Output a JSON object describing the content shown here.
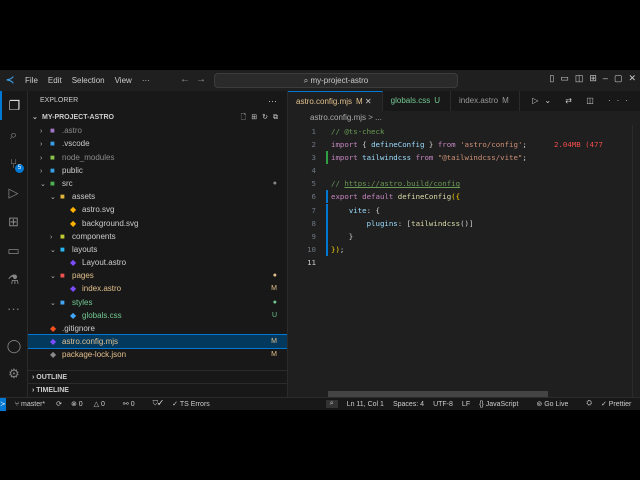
{
  "titlebar": {
    "menu": [
      "File",
      "Edit",
      "Selection",
      "View",
      "···"
    ],
    "search": "my-project-astro"
  },
  "activity": {
    "scm_badge": "5"
  },
  "explorer": {
    "header": "EXPLORER",
    "project": "MY-PROJECT-ASTRO",
    "items": [
      {
        "label": ".astro",
        "depth": 0,
        "kind": "folder",
        "open": false,
        "color": "#8a8a8a",
        "icon": "#a074c4",
        "status": ""
      },
      {
        "label": ".vscode",
        "depth": 0,
        "kind": "folder",
        "open": false,
        "color": "#cccccc",
        "icon": "#3a9ee6",
        "status": ""
      },
      {
        "label": "node_modules",
        "depth": 0,
        "kind": "folder",
        "open": false,
        "color": "#8a8a8a",
        "icon": "#8bc34a",
        "status": ""
      },
      {
        "label": "public",
        "depth": 0,
        "kind": "folder",
        "open": false,
        "color": "#cccccc",
        "icon": "#3a9ee6",
        "status": ""
      },
      {
        "label": "src",
        "depth": 0,
        "kind": "folder",
        "open": true,
        "color": "#cccccc",
        "icon": "#4caf50",
        "status": "●"
      },
      {
        "label": "assets",
        "depth": 1,
        "kind": "folder",
        "open": true,
        "color": "#cccccc",
        "icon": "#e2b33c",
        "status": ""
      },
      {
        "label": "astro.svg",
        "depth": 2,
        "kind": "file",
        "color": "#cccccc",
        "icon": "#ffb300",
        "status": ""
      },
      {
        "label": "background.svg",
        "depth": 2,
        "kind": "file",
        "color": "#cccccc",
        "icon": "#ffb300",
        "status": ""
      },
      {
        "label": "components",
        "depth": 1,
        "kind": "folder",
        "open": false,
        "color": "#cccccc",
        "icon": "#c0ca33",
        "status": ""
      },
      {
        "label": "layouts",
        "depth": 1,
        "kind": "folder",
        "open": true,
        "color": "#cccccc",
        "icon": "#29b6f6",
        "status": ""
      },
      {
        "label": "Layout.astro",
        "depth": 2,
        "kind": "file",
        "color": "#cccccc",
        "icon": "#7c4dff",
        "status": ""
      },
      {
        "label": "pages",
        "depth": 1,
        "kind": "folder",
        "open": true,
        "color": "#e2c08d",
        "icon": "#ef5350",
        "status": "●"
      },
      {
        "label": "index.astro",
        "depth": 2,
        "kind": "file",
        "color": "#e2c08d",
        "icon": "#7c4dff",
        "status": "M"
      },
      {
        "label": "styles",
        "depth": 1,
        "kind": "folder",
        "open": true,
        "color": "#73c991",
        "icon": "#42a5f5",
        "status": "●"
      },
      {
        "label": "globals.css",
        "depth": 2,
        "kind": "file",
        "color": "#73c991",
        "icon": "#42a5f5",
        "status": "U"
      },
      {
        "label": ".gitignore",
        "depth": 0,
        "kind": "file",
        "color": "#cccccc",
        "icon": "#f4511e",
        "status": ""
      },
      {
        "label": "astro.config.mjs",
        "depth": 0,
        "kind": "file",
        "color": "#e2c08d",
        "icon": "#7c4dff",
        "status": "M",
        "selected": true
      },
      {
        "label": "package-lock.json",
        "depth": 0,
        "kind": "file",
        "color": "#e2c08d",
        "icon": "#8a8a8a",
        "status": "M"
      },
      {
        "label": "package.json",
        "depth": 0,
        "kind": "file",
        "color": "#e2c08d",
        "icon": "#8a8a8a",
        "status": "M"
      }
    ],
    "outline": "OUTLINE",
    "timeline": "TIMELINE"
  },
  "tabs": [
    {
      "label": "astro.config.mjs",
      "status": "M",
      "active": true
    },
    {
      "label": "globals.css",
      "status": "U"
    },
    {
      "label": "index.astro",
      "status": "M"
    }
  ],
  "breadcrumb": [
    "astro.config.mjs",
    ">",
    "..."
  ],
  "code": [
    [
      [
        "c",
        "// @ts-check"
      ]
    ],
    [
      [
        "k",
        "import"
      ],
      [
        "p",
        " { "
      ],
      [
        "v",
        "defineConfig"
      ],
      [
        "p",
        " } "
      ],
      [
        "k",
        "from"
      ],
      [
        "p",
        " "
      ],
      [
        "s",
        "'astro/config'"
      ],
      [
        "p",
        ";"
      ]
    ],
    [
      [
        "k",
        "import"
      ],
      [
        "p",
        " "
      ],
      [
        "v",
        "tailwindcss"
      ],
      [
        "p",
        " "
      ],
      [
        "k",
        "from"
      ],
      [
        "p",
        " "
      ],
      [
        "s",
        "\"@tailwindcss/vite\""
      ],
      [
        "p",
        ";"
      ]
    ],
    [],
    [
      [
        "c",
        "// "
      ],
      [
        "u",
        "https://astro.build/config"
      ]
    ],
    [
      [
        "k",
        "export"
      ],
      [
        "p",
        " "
      ],
      [
        "k",
        "default"
      ],
      [
        "p",
        " "
      ],
      [
        "f",
        "defineConfig"
      ],
      [
        "y",
        "({"
      ]
    ],
    [
      [
        "p",
        "    "
      ],
      [
        "v",
        "vite"
      ],
      [
        "p",
        ": {"
      ]
    ],
    [
      [
        "p",
        "        "
      ],
      [
        "v",
        "plugins"
      ],
      [
        "p",
        ": ["
      ],
      [
        "f",
        "tailwindcss"
      ],
      [
        "p",
        "()]"
      ]
    ],
    [
      [
        "p",
        "    }"
      ]
    ],
    [
      [
        "y",
        "})"
      ],
      [
        "p",
        ";"
      ]
    ],
    []
  ],
  "import_cost": "2.04MB (477",
  "status": {
    "branch": "master*",
    "errors": "0",
    "warnings": "0",
    "ports": "0",
    "ts": "TS Errors",
    "position": "Ln 11, Col 1",
    "spaces": "Spaces: 4",
    "encoding": "UTF-8",
    "eol": "LF",
    "language": "JavaScript",
    "golive": "Go Live",
    "prettier": "Prettier"
  }
}
